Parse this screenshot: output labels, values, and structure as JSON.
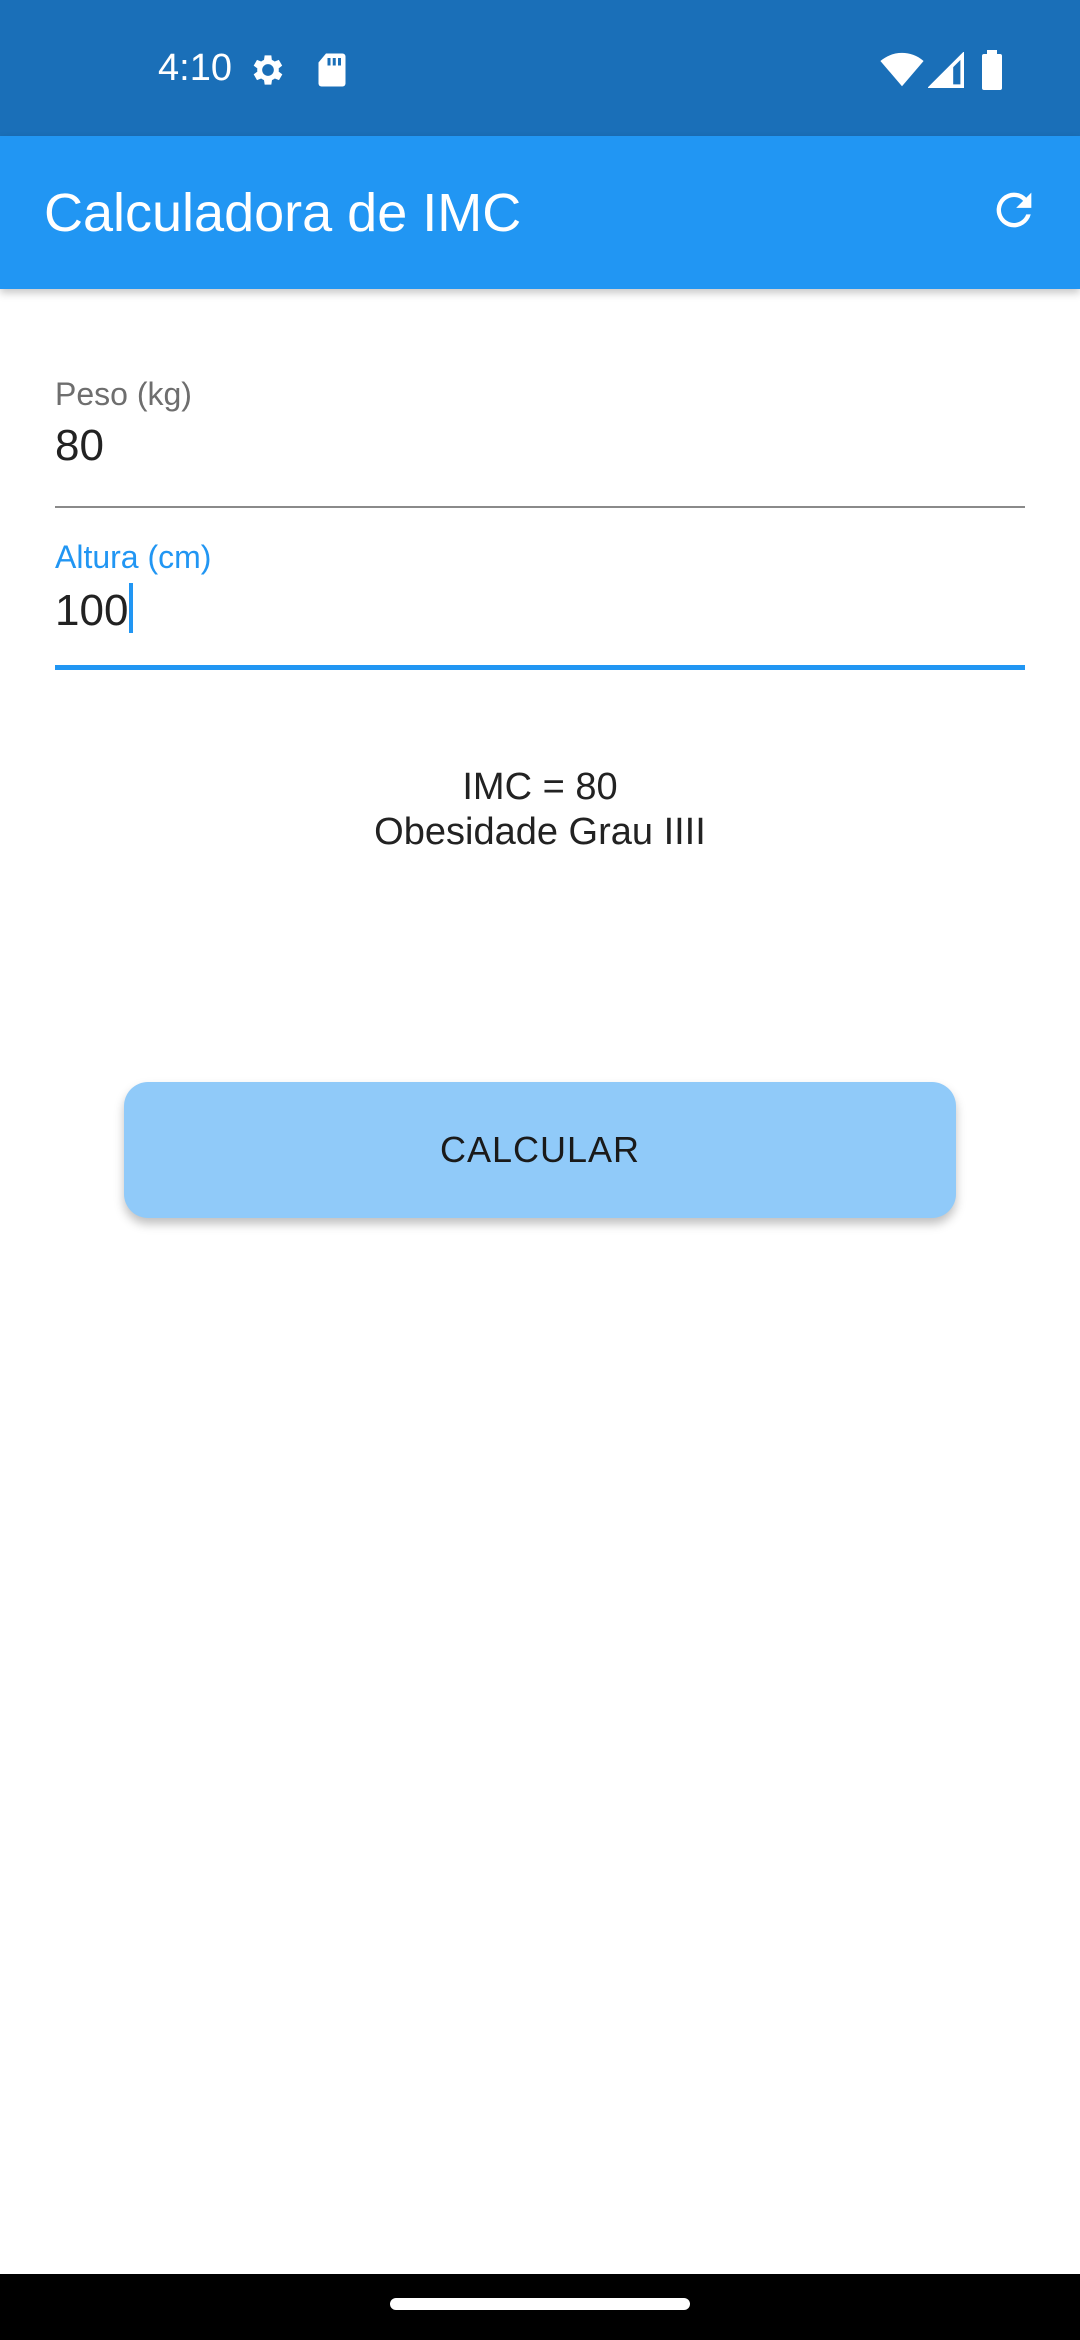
{
  "status_bar": {
    "time": "4:10",
    "icons": [
      "settings-gear-icon",
      "sd-card-icon",
      "wifi-icon",
      "signal-icon",
      "battery-icon"
    ]
  },
  "app_bar": {
    "title": "Calculadora de IMC",
    "refresh_icon": "refresh-icon"
  },
  "form": {
    "peso": {
      "label": "Peso (kg)",
      "value": "80"
    },
    "altura": {
      "label": "Altura (cm)",
      "value": "100"
    }
  },
  "result": {
    "imc_line": "IMC = 80",
    "category_line": "Obesidade Grau IIII"
  },
  "calculate_button": {
    "label": "CALCULAR"
  },
  "colors": {
    "status_bar": "#1a6fb8",
    "app_bar": "#2196f3",
    "accent": "#2196f3",
    "button": "#90caf9",
    "nav_bar": "#000000"
  }
}
